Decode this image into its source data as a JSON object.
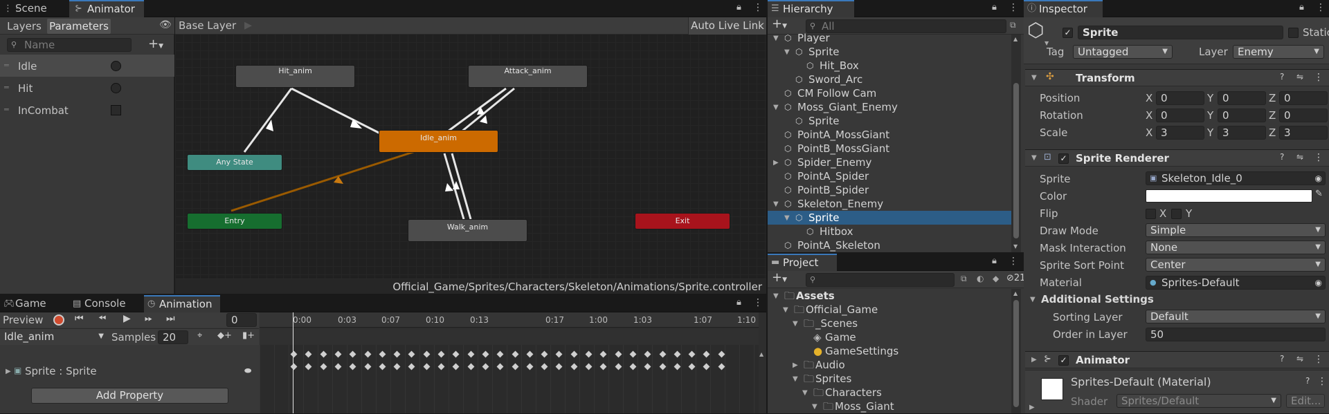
{
  "animator": {
    "tabs": [
      {
        "label": "Scene",
        "icon": "grid-icon"
      },
      {
        "label": "Animator",
        "icon": "animator-icon"
      }
    ],
    "sub_tabs": [
      "Layers",
      "Parameters"
    ],
    "search_placeholder": "Name",
    "parameters": [
      {
        "name": "Idle",
        "type": "trigger"
      },
      {
        "name": "Hit",
        "type": "trigger"
      },
      {
        "name": "InCombat",
        "type": "bool"
      }
    ],
    "breadcrumb": "Base Layer",
    "auto_live_link": "Auto Live Link",
    "states": {
      "hit": "Hit_anim",
      "attack": "Attack_anim",
      "idle": "Idle_anim",
      "any": "Any State",
      "entry": "Entry",
      "walk": "Walk_anim",
      "exit": "Exit"
    },
    "path": "Official_Game/Sprites/Characters/Skeleton/Animations/Sprite.controller"
  },
  "bottom": {
    "tabs": [
      {
        "label": "Game"
      },
      {
        "label": "Console"
      },
      {
        "label": "Animation"
      }
    ],
    "preview": "Preview",
    "frame": "0",
    "clip": "Idle_anim",
    "samples_label": "Samples",
    "samples": "20",
    "ticks": [
      "0:00",
      "0:03",
      "0:07",
      "0:10",
      "0:13",
      "0:17",
      "1:00",
      "1:03",
      "1:07",
      "1:10"
    ],
    "property": "Sprite : Sprite",
    "add_property": "Add Property"
  },
  "hierarchy": {
    "title": "Hierarchy",
    "search_placeholder": "All",
    "items": [
      "Player",
      "Sprite",
      "Hit_Box",
      "Sword_Arc",
      "CM Follow Cam",
      "Moss_Giant_Enemy",
      "Sprite",
      "PointA_MossGiant",
      "PointB_MossGiant",
      "Spider_Enemy",
      "PointA_Spider",
      "PointB_Spider",
      "Skeleton_Enemy",
      "Sprite",
      "Hitbox",
      "PointA_Skeleton"
    ]
  },
  "project": {
    "title": "Project",
    "hidden_count": "21",
    "items": [
      "Assets",
      "Official_Game",
      "_Scenes",
      "Game",
      "GameSettings",
      "Audio",
      "Sprites",
      "Characters",
      "Moss_Giant"
    ]
  },
  "inspector": {
    "title": "Inspector",
    "object_name": "Sprite",
    "static_label": "Static",
    "tag_label": "Tag",
    "tag": "Untagged",
    "layer_label": "Layer",
    "layer": "Enemy",
    "transform": {
      "title": "Transform",
      "position_label": "Position",
      "rotation_label": "Rotation",
      "scale_label": "Scale",
      "axes": [
        "X",
        "Y",
        "Z"
      ],
      "position": [
        "0",
        "0",
        "0"
      ],
      "rotation": [
        "0",
        "0",
        "0"
      ],
      "scale": [
        "3",
        "3",
        "3"
      ]
    },
    "sprite_renderer": {
      "title": "Sprite Renderer",
      "labels": [
        "Sprite",
        "Color",
        "Flip",
        "Draw Mode",
        "Mask Interaction",
        "Sprite Sort Point",
        "Material"
      ],
      "sprite": "Skeleton_Idle_0",
      "color": "#ffffff",
      "flip_x": "X",
      "flip_y": "Y",
      "draw_mode": "Simple",
      "mask_interaction": "None",
      "sort_point": "Center",
      "material": "Sprites-Default",
      "additional": "Additional Settings",
      "sorting_layer_label": "Sorting Layer",
      "sorting_layer": "Default",
      "order_label": "Order in Layer",
      "order": "50"
    },
    "animator_component": "Animator",
    "material_title": "Sprites-Default (Material)",
    "shader_label": "Shader",
    "shader": "Sprites/Default",
    "edit": "Edit..."
  }
}
